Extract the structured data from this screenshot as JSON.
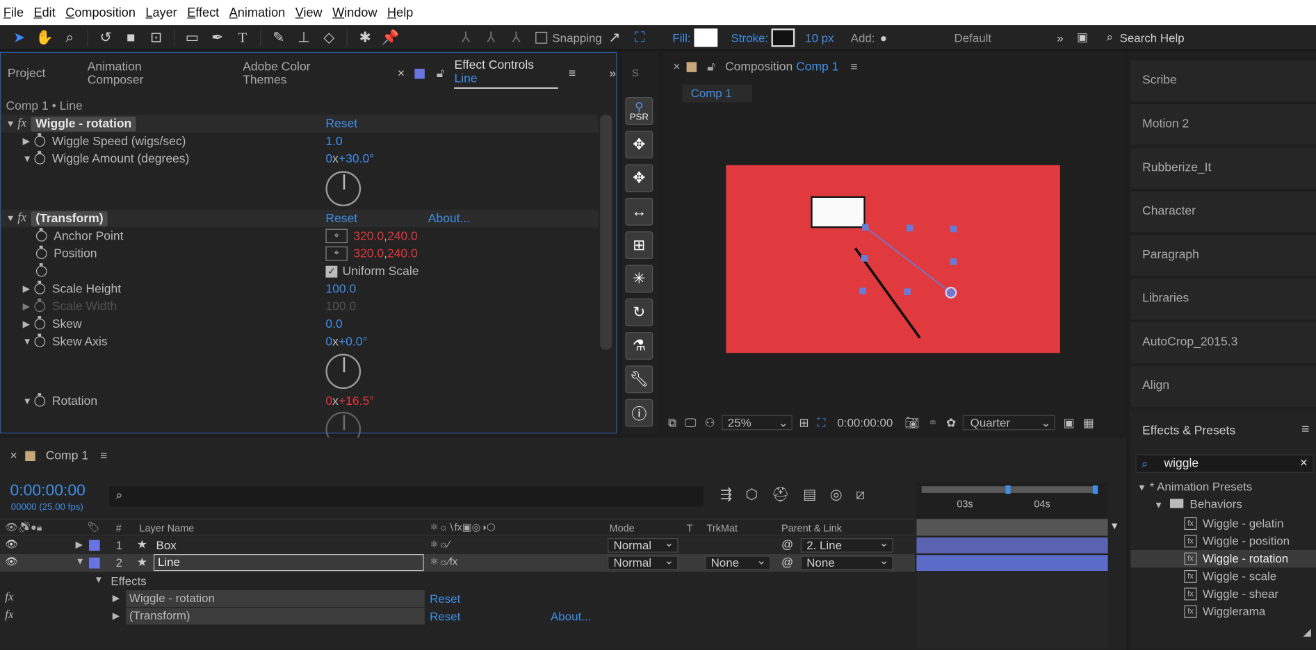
{
  "menu": [
    "File",
    "Edit",
    "Composition",
    "Layer",
    "Effect",
    "Animation",
    "View",
    "Window",
    "Help"
  ],
  "toolbar": {
    "snapping": "Snapping",
    "fill_label": "Fill:",
    "stroke_label": "Stroke:",
    "stroke_width": "10 px",
    "add_label": "Add:",
    "workspace": "Default",
    "search_placeholder": "Search Help"
  },
  "left_tabs": {
    "project": "Project",
    "animation_composer": "Animation Composer",
    "color_themes": "Adobe Color Themes",
    "effect_controls_prefix": "Effect Controls",
    "effect_controls_layer": "Line"
  },
  "effect_controls": {
    "breadcrumb": "Comp 1 • Line",
    "wiggle_name": "Wiggle - rotation",
    "reset": "Reset",
    "about": "About...",
    "wiggle_speed_label": "Wiggle Speed (wigs/sec)",
    "wiggle_speed_value": "1.0",
    "wiggle_amount_label": "Wiggle Amount (degrees)",
    "wiggle_amount_rev": "0",
    "wiggle_amount_x": "x",
    "wiggle_amount_deg": "+30.0",
    "transform_name": "(Transform)",
    "anchor_label": "Anchor Point",
    "anchor_x": "320.0",
    "anchor_y": "240.0",
    "position_label": "Position",
    "position_x": "320.0",
    "position_y": "240.0",
    "uniform_scale": "Uniform Scale",
    "scale_height_label": "Scale Height",
    "scale_height_value": "100.0",
    "scale_width_label": "Scale Width",
    "scale_width_value": "100.0",
    "skew_label": "Skew",
    "skew_value": "0.0",
    "skew_axis_label": "Skew Axis",
    "skew_axis_rev": "0",
    "skew_axis_deg": "+0.0",
    "rotation_label": "Rotation",
    "rotation_rev": "0",
    "rotation_deg": "+16.5"
  },
  "composition": {
    "panel_title_prefix": "Composition",
    "panel_title_comp": "Comp 1",
    "tab": "Comp 1",
    "zoom": "25%",
    "timecode": "0:00:00:00",
    "resolution": "Quarter",
    "canvas_color": "#e0393e"
  },
  "right_panels": [
    "Scribe",
    "Motion 2",
    "Rubberize_It",
    "Character",
    "Paragraph",
    "Libraries",
    "AutoCrop_2015.3",
    "Align"
  ],
  "effects_presets": {
    "title": "Effects & Presets",
    "search_value": "wiggle",
    "animation_presets": "* Animation Presets",
    "behaviors": "Behaviors",
    "items": [
      "Wiggle - gelatin",
      "Wiggle - position",
      "Wiggle - rotation",
      "Wiggle - scale",
      "Wiggle - shear",
      "Wigglerama"
    ],
    "selected_index": 2
  },
  "timeline": {
    "comp_name": "Comp 1",
    "timecode": "0:00:00:00",
    "frame_info": "00000 (25.00 fps)",
    "ruler": [
      "03s",
      "04s"
    ],
    "headers": {
      "num": "#",
      "layer_name": "Layer Name",
      "mode": "Mode",
      "t": "T",
      "trkmat": "TrkMat",
      "parent": "Parent & Link"
    },
    "layers": [
      {
        "num": "1",
        "name": "Box",
        "mode": "Normal",
        "trkmat": "",
        "parent": "2. Line"
      },
      {
        "num": "2",
        "name": "Line",
        "mode": "Normal",
        "trkmat": "None",
        "parent": "None"
      }
    ],
    "effects_label": "Effects",
    "fx_rows": [
      {
        "name": "Wiggle - rotation",
        "reset": "Reset",
        "about": ""
      },
      {
        "name": "(Transform)",
        "reset": "Reset",
        "about": "About..."
      }
    ]
  },
  "psr": {
    "label": "PSR"
  }
}
